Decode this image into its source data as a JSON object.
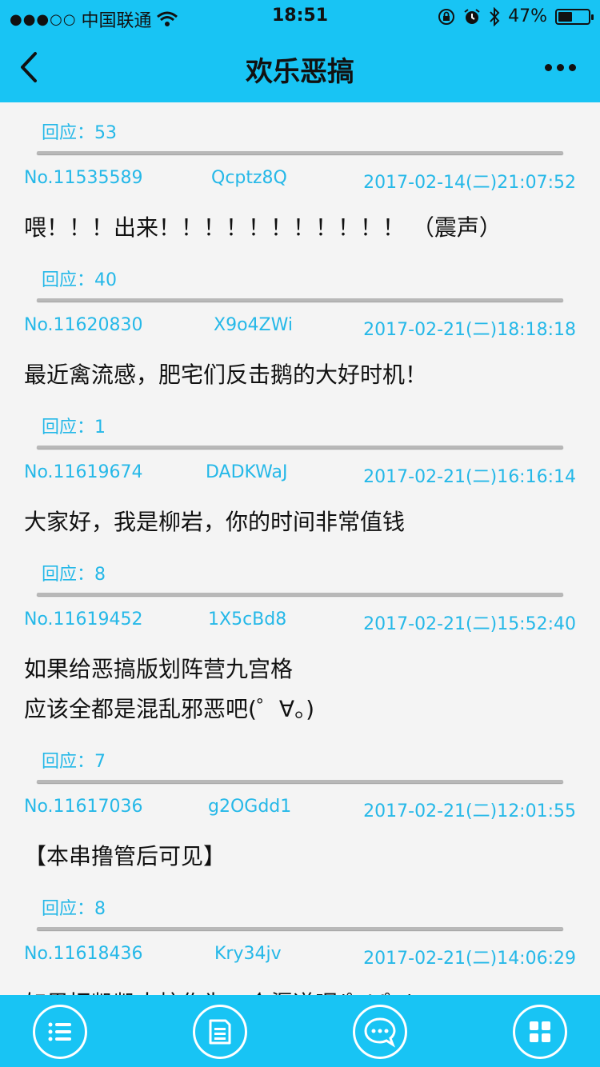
{
  "status_bar": {
    "signal": "●●●○○",
    "carrier": "中国联通",
    "time": "18:51",
    "battery": "47%",
    "battery_level": 0.47
  },
  "header": {
    "title": "欢乐恶搞"
  },
  "posts": [
    {
      "reply_label": "回应：53"
    },
    {
      "no": "No.11535589",
      "uid": "Qcptz8Q",
      "date": "2017-02-14(二)21:07:52",
      "text": "喂！！！出来！！！！！！！！！！！ （震声）",
      "reply_label": "回应：40"
    },
    {
      "no": "No.11620830",
      "uid": "X9o4ZWi",
      "date": "2017-02-21(二)18:18:18",
      "text": "最近禽流感，肥宅们反击鹅的大好时机！",
      "reply_label": "回应：1"
    },
    {
      "no": "No.11619674",
      "uid": "DADKWaJ",
      "date": "2017-02-21(二)16:16:14",
      "text": "大家好，我是柳岩，你的时间非常值钱",
      "reply_label": "回应：8"
    },
    {
      "no": "No.11619452",
      "uid": "1X5cBd8",
      "date": "2017-02-21(二)15:52:40",
      "text": "如果给恶搞版划阵营九宫格\n应该全都是混乱邪恶吧(゜∀。)",
      "reply_label": "回应：7"
    },
    {
      "no": "No.11617036",
      "uid": "g2OGdd1",
      "date": "2017-02-21(二)12:01:55",
      "text": "【本串撸管后可见】",
      "reply_label": "回应：8"
    },
    {
      "no": "No.11618436",
      "uid": "Kry34jv",
      "date": "2017-02-21(二)14:06:29",
      "text": "如果把凯凯大校作为一个渠道呢(゜∀゜)"
    }
  ],
  "colors": {
    "accent": "#18c4f4",
    "link": "#25b8e8",
    "background": "#f4f4f4"
  },
  "tabs": [
    {
      "icon": "list-icon"
    },
    {
      "icon": "document-icon"
    },
    {
      "icon": "chat-icon"
    },
    {
      "icon": "grid-icon"
    }
  ]
}
